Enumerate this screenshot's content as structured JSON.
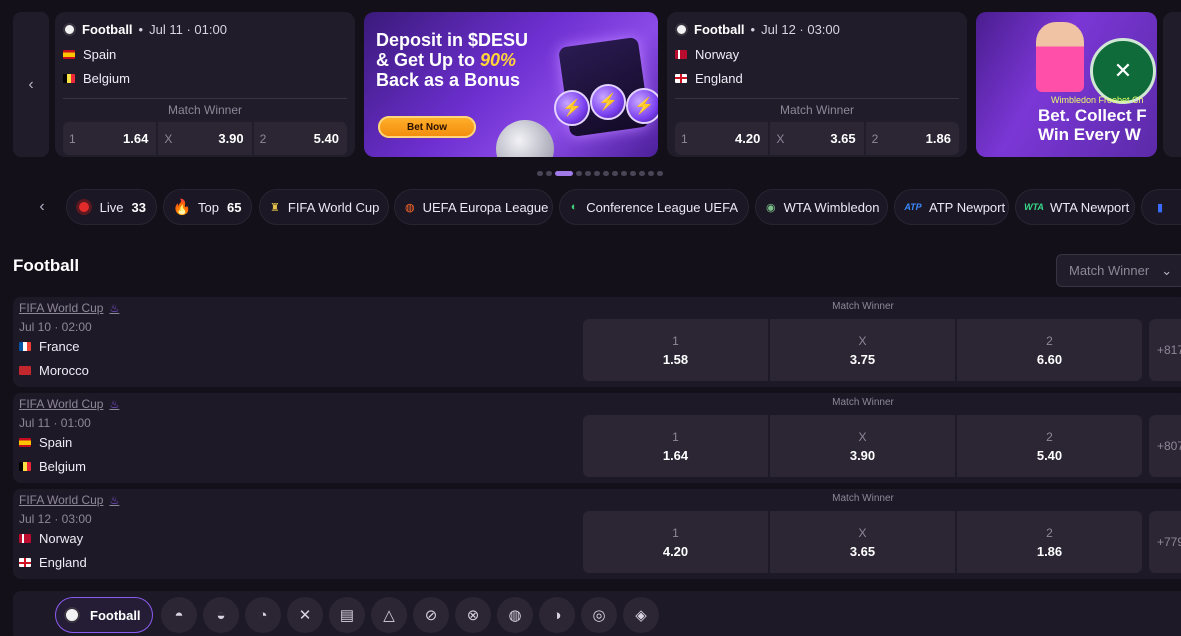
{
  "carousel": {
    "cards": [
      {
        "sport": "Football",
        "date": "Jul 11 · 01:00",
        "home": "Spain",
        "away": "Belgium",
        "market": "Match Winner",
        "odds": [
          {
            "label": "1",
            "value": "1.64"
          },
          {
            "label": "X",
            "value": "3.90"
          },
          {
            "label": "2",
            "value": "5.40"
          }
        ]
      },
      {
        "sport": "Football",
        "date": "Jul 12 · 03:00",
        "home": "Norway",
        "away": "England",
        "market": "Match Winner",
        "odds": [
          {
            "label": "1",
            "value": "4.20"
          },
          {
            "label": "X",
            "value": "3.65"
          },
          {
            "label": "2",
            "value": "1.86"
          }
        ]
      }
    ],
    "banner1": {
      "line1": "Deposit in $DESU",
      "line2_pre": "& Get Up to ",
      "line2_hl": "90%",
      "line3": "Back as a Bonus",
      "button": "Bet Now"
    },
    "banner2": {
      "small": "Wimbledon Freebet Ch",
      "line1": "Bet. Collect F",
      "line2": "Win Every W"
    },
    "active_slide": 3,
    "slide_count": 13
  },
  "chips": [
    {
      "label": "Live",
      "count": "33"
    },
    {
      "label": "Top",
      "count": "65"
    },
    {
      "label": "FIFA World Cup"
    },
    {
      "label": "UEFA Europa League"
    },
    {
      "label": "Conference League UEFA"
    },
    {
      "label": "WTA Wimbledon"
    },
    {
      "label": "ATP Newport"
    },
    {
      "label": "WTA Newport"
    }
  ],
  "section": {
    "title": "Football",
    "market_select": "Match Winner"
  },
  "matches": [
    {
      "league": "FIFA World Cup",
      "date": "Jul 10 · 02:00",
      "home": "France",
      "away": "Morocco",
      "market": "Match Winner",
      "odds": [
        {
          "label": "1",
          "value": "1.58"
        },
        {
          "label": "X",
          "value": "3.75"
        },
        {
          "label": "2",
          "value": "6.60"
        }
      ],
      "more": "+817"
    },
    {
      "league": "FIFA World Cup",
      "date": "Jul 11 · 01:00",
      "home": "Spain",
      "away": "Belgium",
      "market": "Match Winner",
      "odds": [
        {
          "label": "1",
          "value": "1.64"
        },
        {
          "label": "X",
          "value": "3.90"
        },
        {
          "label": "2",
          "value": "5.40"
        }
      ],
      "more": "+807"
    },
    {
      "league": "FIFA World Cup",
      "date": "Jul 12 · 03:00",
      "home": "Norway",
      "away": "England",
      "market": "Match Winner",
      "odds": [
        {
          "label": "1",
          "value": "4.20"
        },
        {
          "label": "X",
          "value": "3.65"
        },
        {
          "label": "2",
          "value": "1.86"
        }
      ],
      "more": "+779"
    }
  ],
  "sportbar": {
    "active": "Football"
  },
  "icons": {
    "ticket-chip": "fire-icon",
    "sport-icons": [
      "basketball-icon",
      "basketball-icon",
      "tennis-icon",
      "hockey-icon",
      "boxing-icon",
      "snooker-icon",
      "rugby-icon",
      "american-football-icon",
      "volleyball-icon",
      "baseball-icon",
      "rugby-ball-icon",
      "darts-icon"
    ]
  },
  "colors": {
    "background": "#13101a",
    "card": "#211c29",
    "accent": "#8a5cf0",
    "live": "#e22b2b"
  }
}
